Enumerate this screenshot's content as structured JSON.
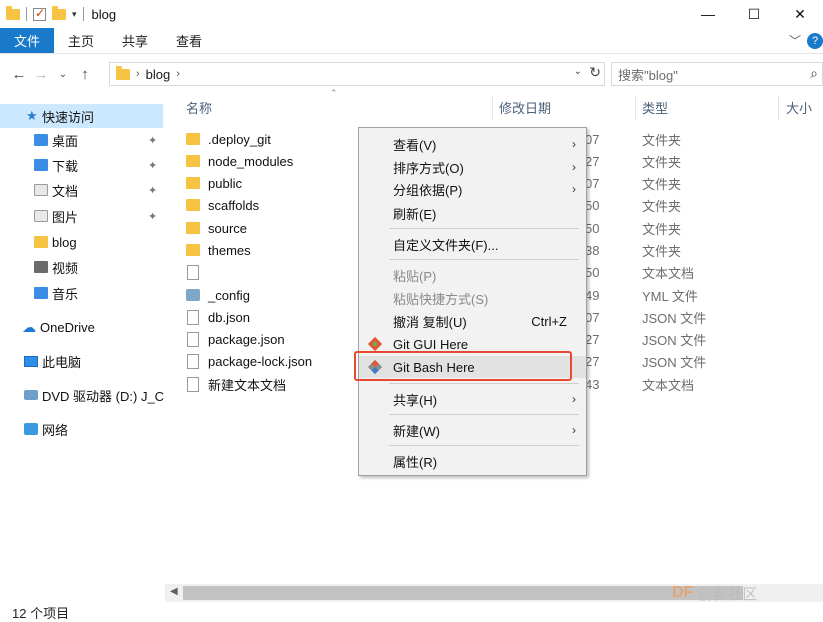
{
  "window": {
    "title": "blog",
    "controls": {
      "minimize": "—",
      "maximize": "☐",
      "close": "✕"
    }
  },
  "ribbon": {
    "tabs": [
      {
        "label": "文件"
      },
      {
        "label": "主页"
      },
      {
        "label": "共享"
      },
      {
        "label": "查看"
      }
    ],
    "help": "?"
  },
  "address": {
    "path": "blog",
    "search_placeholder": "搜索\"blog\""
  },
  "nav": {
    "quick_access": "快速访问",
    "items": [
      {
        "label": "桌面"
      },
      {
        "label": "下载"
      },
      {
        "label": "文档"
      },
      {
        "label": "图片"
      },
      {
        "label": "blog"
      },
      {
        "label": "视频"
      },
      {
        "label": "音乐"
      }
    ],
    "onedrive": "OneDrive",
    "this_pc": "此电脑",
    "dvd": "DVD 驱动器 (D:) J_C",
    "network": "网络"
  },
  "columns": {
    "name": "名称",
    "date": "修改日期",
    "type": "类型",
    "size": "大小"
  },
  "files": [
    {
      "name": ".deploy_git",
      "date": "07",
      "type": "文件夹",
      "icon": "folder"
    },
    {
      "name": "node_modules",
      "date": "27",
      "type": "文件夹",
      "icon": "folder"
    },
    {
      "name": "public",
      "date": "07",
      "type": "文件夹",
      "icon": "folder"
    },
    {
      "name": "scaffolds",
      "date": "50",
      "type": "文件夹",
      "icon": "folder"
    },
    {
      "name": "source",
      "date": "50",
      "type": "文件夹",
      "icon": "folder"
    },
    {
      "name": "themes",
      "date": "38",
      "type": "文件夹",
      "icon": "folder"
    },
    {
      "name": "",
      "date": "50",
      "type": "文本文档",
      "icon": "file"
    },
    {
      "name": "_config",
      "date": "49",
      "type": "YML 文件",
      "icon": "yml"
    },
    {
      "name": "db.json",
      "date": "07",
      "type": "JSON 文件",
      "icon": "file"
    },
    {
      "name": "package.json",
      "date": "27",
      "type": "JSON 文件",
      "icon": "file"
    },
    {
      "name": "package-lock.json",
      "date": "27",
      "type": "JSON 文件",
      "icon": "file"
    },
    {
      "name": "新建文本文档",
      "date": "43",
      "type": "文本文档",
      "icon": "file"
    }
  ],
  "context_menu": {
    "view": "查看(V)",
    "sort": "排序方式(O)",
    "group": "分组依据(P)",
    "refresh": "刷新(E)",
    "customize": "自定义文件夹(F)...",
    "paste": "粘贴(P)",
    "paste_shortcut": "粘贴快捷方式(S)",
    "undo": "撤消 复制(U)",
    "undo_shortcut": "Ctrl+Z",
    "git_gui": "Git GUI Here",
    "git_bash": "Git Bash Here",
    "share": "共享(H)",
    "new": "新建(W)",
    "properties": "属性(R)"
  },
  "status": {
    "count": "12 个项目"
  },
  "watermark": {
    "brand": "DF",
    "text": "创客社区"
  },
  "colors": {
    "accent": "#1979ca",
    "selection": "#cce8ff",
    "highlight_border": "#e8492f"
  }
}
